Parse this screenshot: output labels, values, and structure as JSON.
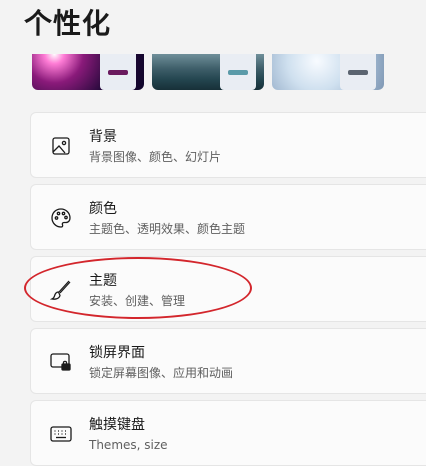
{
  "page": {
    "title": "个性化"
  },
  "themes": [
    {
      "name": "theme-glow",
      "accent": "#6a1a5e"
    },
    {
      "name": "theme-lake",
      "accent": "#5a9aa8"
    },
    {
      "name": "theme-bloom",
      "accent": "#5b6470"
    }
  ],
  "settings": [
    {
      "id": "background",
      "icon": "image-icon",
      "title": "背景",
      "subtitle": "背景图像、颜色、幻灯片"
    },
    {
      "id": "colors",
      "icon": "palette-icon",
      "title": "颜色",
      "subtitle": "主题色、透明效果、颜色主题"
    },
    {
      "id": "themes",
      "icon": "brush-icon",
      "title": "主题",
      "subtitle": "安装、创建、管理"
    },
    {
      "id": "lockscreen",
      "icon": "lock-screen-icon",
      "title": "锁屏界面",
      "subtitle": "锁定屏幕图像、应用和动画"
    },
    {
      "id": "touch-keyboard",
      "icon": "keyboard-icon",
      "title": "触摸键盘",
      "subtitle": "Themes, size"
    }
  ],
  "annotation": {
    "color": "#d3262c"
  }
}
